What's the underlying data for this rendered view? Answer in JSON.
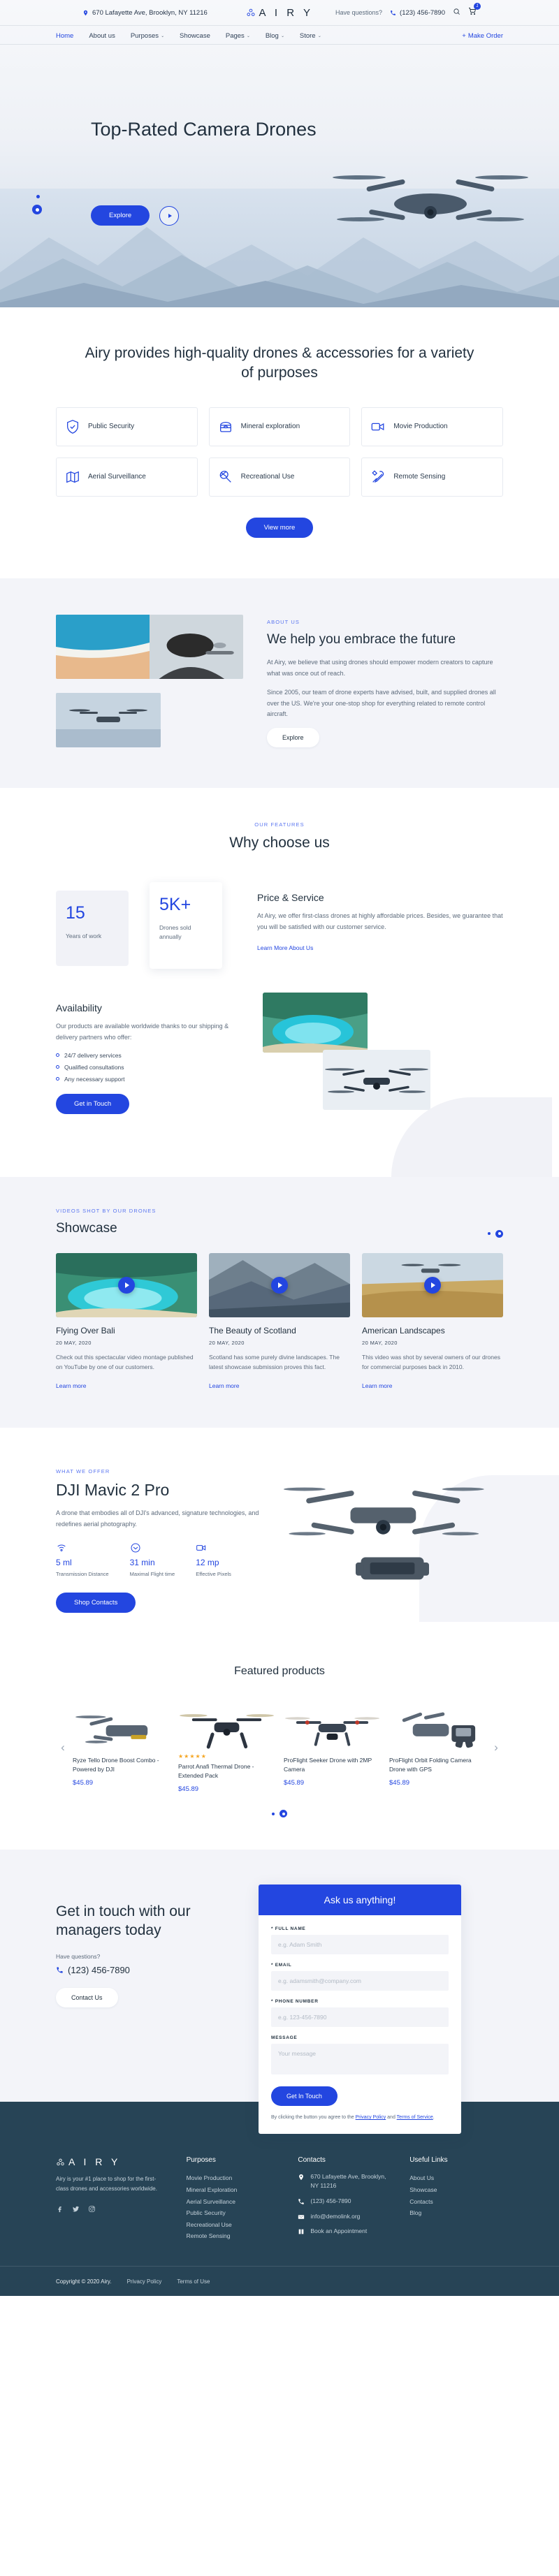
{
  "topbar": {
    "address": "670 Lafayette Ave, Brooklyn, NY 11216",
    "brand": "A I R Y",
    "have_questions": "Have questions?",
    "phone": "(123) 456-7890",
    "cart_count": "1"
  },
  "nav": {
    "items": [
      {
        "label": "Home",
        "caret": "",
        "active": true
      },
      {
        "label": "About us",
        "caret": "",
        "active": false
      },
      {
        "label": "Purposes",
        "caret": "⌄",
        "active": false
      },
      {
        "label": "Showcase",
        "caret": "",
        "active": false
      },
      {
        "label": "Pages",
        "caret": "⌄",
        "active": false
      },
      {
        "label": "Blog",
        "caret": "⌄",
        "active": false
      },
      {
        "label": "Store",
        "caret": "⌄",
        "active": false
      }
    ],
    "make_order": "Make Order",
    "make_order_plus": "+"
  },
  "hero": {
    "title": "Top-Rated Camera Drones",
    "explore": "Explore"
  },
  "purposes": {
    "heading": "Airy provides high-quality drones & accessories for a variety of purposes",
    "cards": [
      {
        "label": "Public Security",
        "icon": "shield-check-icon"
      },
      {
        "label": "Mineral exploration",
        "icon": "mine-cart-icon"
      },
      {
        "label": "Movie Production",
        "icon": "video-camera-icon"
      },
      {
        "label": "Aerial Surveillance",
        "icon": "map-icon"
      },
      {
        "label": "Recreational Use",
        "icon": "badminton-racket-icon"
      },
      {
        "label": "Remote Sensing",
        "icon": "tools-icon"
      }
    ],
    "view_more": "View more"
  },
  "about": {
    "eyebrow": "ABOUT US",
    "heading": "We help you embrace the future",
    "p1": "At Airy, we believe that using drones should empower modern creators to capture what was once out of reach.",
    "p2": "Since 2005, our team of drone experts have advised, built, and supplied drones all over the US. We're your one-stop shop for everything related to remote control aircraft.",
    "explore": "Explore"
  },
  "features": {
    "eyebrow": "OUR FEATURES",
    "heading": "Why choose us",
    "stats": [
      {
        "number": "15",
        "label": "Years of work"
      },
      {
        "number": "5K+",
        "label": "Drones sold annually"
      }
    ],
    "price_title": "Price & Service",
    "price_text": "At Airy, we offer first-class drones at highly affordable prices. Besides, we guarantee that you will be satisfied with our customer service.",
    "price_link": "Learn More About Us",
    "avail_title": "Availability",
    "avail_text": "Our products are available worldwide thanks to our shipping & delivery partners who offer:",
    "avail_list": [
      "24/7 delivery services",
      "Qualified consultations",
      "Any necessary support"
    ],
    "avail_btn": "Get in Touch"
  },
  "showcase": {
    "eyebrow": "VIDEOS SHOT BY OUR DRONES",
    "heading": "Showcase",
    "items": [
      {
        "title": "Flying Over Bali",
        "date": "20 MAY, 2020",
        "desc": "Check out this spectacular video montage published on YouTube by one of our customers.",
        "link": "Learn more"
      },
      {
        "title": "The Beauty of Scotland",
        "date": "20 MAY, 2020",
        "desc": "Scotland has some purely divine landscapes. The latest showcase submission proves this fact.",
        "link": "Learn more"
      },
      {
        "title": "American Landscapes",
        "date": "20 MAY, 2020",
        "desc": "This video was shot by several owners of our drones for commercial purposes back in 2010.",
        "link": "Learn more"
      }
    ]
  },
  "offer": {
    "eyebrow": "WHAT WE OFFER",
    "title": "DJI Mavic 2 Pro",
    "desc": "A drone that embodies all of DJI's advanced, signature technologies, and redefines aerial photography.",
    "specs": [
      {
        "value": "5 ml",
        "label": "Transmission Distance",
        "icon": "signal-icon"
      },
      {
        "value": "31 min",
        "label": "Maximal Flight time",
        "icon": "clock-icon"
      },
      {
        "value": "12 mp",
        "label": "Effective Pixels",
        "icon": "video-camera-icon"
      }
    ],
    "btn": "Shop Contacts"
  },
  "products": {
    "heading": "Featured products",
    "items": [
      {
        "name": "Ryze Tello Drone Boost Combo - Powered by DJI",
        "price": "$45.89",
        "stars": ""
      },
      {
        "name": "Parrot Anafi Thermal Drone - Extended Pack",
        "price": "$45.89",
        "stars": "★★★★★"
      },
      {
        "name": "ProFlight Seeker Drone with 2MP Camera",
        "price": "$45.89",
        "stars": ""
      },
      {
        "name": "ProFlight Orbit Folding Camera Drone with GPS",
        "price": "$45.89",
        "stars": ""
      }
    ],
    "prev": "‹",
    "next": "›"
  },
  "contact": {
    "heading": "Get in touch with our managers today",
    "have_questions": "Have questions?",
    "phone": "(123) 456-7890",
    "btn": "Contact Us",
    "form_title": "Ask us anything!",
    "fields": [
      {
        "label": "* FULL NAME",
        "placeholder": "e.g. Adam Smith"
      },
      {
        "label": "* EMAIL",
        "placeholder": "e.g. adamsmith@company.com"
      },
      {
        "label": "* PHONE NUMBER",
        "placeholder": "e.g. 123-456-7890"
      }
    ],
    "message_label": "MESSAGE",
    "message_placeholder": "Your message",
    "submit": "Get In Touch",
    "agree_pre": "By clicking the button you agree to the ",
    "agree_link1": "Privacy Policy",
    "agree_mid": " and ",
    "agree_link2": "Terms of Service",
    "agree_post": "."
  },
  "footer": {
    "brand": "A I R Y",
    "desc": "Airy is your #1 place to shop for the first-class drones and accessories worldwide.",
    "socials": [
      "facebook-icon",
      "twitter-icon",
      "instagram-icon"
    ],
    "purposes_title": "Purposes",
    "purposes": [
      "Movie Production",
      "Mineral Exploration",
      "Aerial Surveillance",
      "Public Security",
      "Recreational Use",
      "Remote Sensing"
    ],
    "contacts_title": "Contacts",
    "contacts": [
      {
        "text": "670 Lafayette Ave, Brooklyn, NY 11216",
        "icon": "pin-icon"
      },
      {
        "text": "(123) 456-7890",
        "icon": "phone-icon"
      },
      {
        "text": "info@demolink.org",
        "icon": "mail-icon"
      },
      {
        "text": "Book an Appointment",
        "icon": "book-icon"
      }
    ],
    "useful_title": "Useful Links",
    "useful": [
      "About Us",
      "Showcase",
      "Contacts",
      "Blog"
    ],
    "copyright": "Copyright © 2020 Airy.",
    "privacy": "Privacy Policy",
    "terms": "Terms of Use"
  },
  "colors": {
    "accent": "#2346e0",
    "dark": "#22313f",
    "footer_bg": "#274456",
    "star": "#f5a623"
  }
}
